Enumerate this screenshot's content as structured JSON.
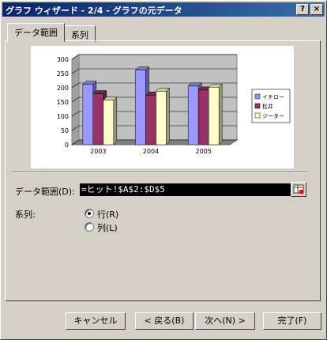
{
  "window": {
    "title": "グラフ ウィザード - 2/4 - グラフの元データ",
    "help_label": "?",
    "close_label": "×"
  },
  "tabs": [
    {
      "label": "データ範囲",
      "active": true
    },
    {
      "label": "系列",
      "active": false
    }
  ],
  "chart_data": {
    "type": "bar",
    "categories": [
      "2003",
      "2004",
      "2005"
    ],
    "series": [
      {
        "name": "イチロー",
        "values": [
          212,
          262,
          206
        ],
        "color": "#9999ff"
      },
      {
        "name": "松井",
        "values": [
          179,
          174,
          192
        ],
        "color": "#993366"
      },
      {
        "name": "ジーター",
        "values": [
          156,
          188,
          202
        ],
        "color": "#ffffcc"
      }
    ],
    "y_ticks": [
      "0",
      "50",
      "100",
      "150",
      "200",
      "250",
      "300"
    ],
    "ylim": [
      0,
      300
    ],
    "grid": true,
    "legend": "right",
    "three_d": true
  },
  "form": {
    "range_label": "データ範囲(D):",
    "range_value": "=ヒット!$A$2:$D$5",
    "series_label": "系列:",
    "series_options": [
      "行(R)",
      "列(L)"
    ],
    "series_selected": "行(R)"
  },
  "buttons": {
    "cancel": "キャンセル",
    "back": "< 戻る(B)",
    "next": "次へ(N) >",
    "finish": "完了(F)"
  }
}
